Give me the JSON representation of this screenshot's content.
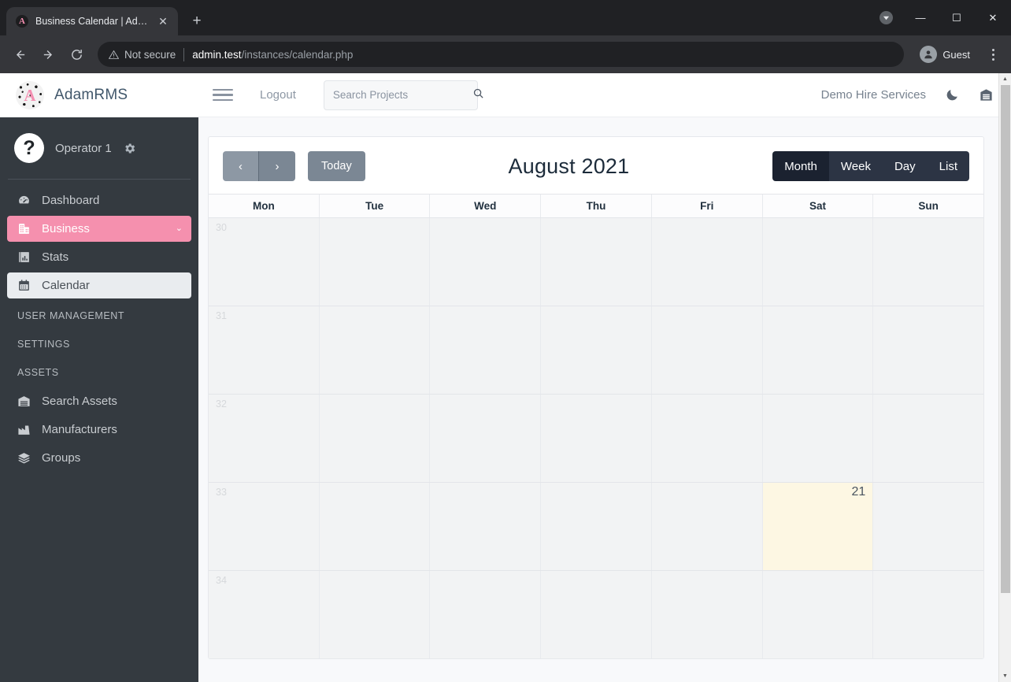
{
  "browser": {
    "tab": {
      "title": "Business Calendar | AdamRMS",
      "favicon_letter": "A",
      "close_icon": "close-icon"
    },
    "new_tab_label": "+",
    "nav": {
      "back_icon": "back-arrow-icon",
      "forward_icon": "forward-arrow-icon",
      "reload_icon": "reload-icon"
    },
    "omnibox": {
      "security_label": "Not secure",
      "url_host": "admin.test",
      "url_path": "/instances/calendar.php"
    },
    "profile_label": "Guest",
    "window_controls": {
      "minimize": "—",
      "maximize": "☐",
      "close": "✕"
    }
  },
  "sidebar": {
    "brand": {
      "name": "AdamRMS",
      "logo_letter": "A"
    },
    "user": {
      "name": "Operator 1",
      "avatar_glyph": "?",
      "settings_icon": "gear-icon"
    },
    "items": [
      {
        "label": "Dashboard",
        "icon": "dashboard-icon",
        "state": "default"
      },
      {
        "label": "Business",
        "icon": "building-icon",
        "state": "active-pink",
        "chevron": "⌄"
      },
      {
        "label": "Stats",
        "icon": "chart-bar-icon",
        "state": "default"
      },
      {
        "label": "Calendar",
        "icon": "calendar-icon",
        "state": "active-light"
      }
    ],
    "sections": [
      {
        "label": "User Management",
        "items": []
      },
      {
        "label": "Settings",
        "items": []
      },
      {
        "label": "Assets",
        "items": [
          {
            "label": "Search Assets",
            "icon": "warehouse-icon"
          },
          {
            "label": "Manufacturers",
            "icon": "factory-icon"
          },
          {
            "label": "Groups",
            "icon": "layers-icon"
          }
        ]
      }
    ]
  },
  "topbar": {
    "menu_toggle_icon": "hamburger-icon",
    "logout_label": "Logout",
    "search": {
      "placeholder": "Search Projects",
      "value": "",
      "icon": "search-icon"
    },
    "org_name": "Demo Hire Services",
    "dark_mode_icon": "moon-icon",
    "warehouse_icon": "warehouse-icon"
  },
  "calendar": {
    "prev_label": "‹",
    "next_label": "›",
    "today_label": "Today",
    "title": "August 2021",
    "views": [
      {
        "label": "Month",
        "active": true
      },
      {
        "label": "Week",
        "active": false
      },
      {
        "label": "Day",
        "active": false
      },
      {
        "label": "List",
        "active": false
      }
    ],
    "day_headers": [
      "Mon",
      "Tue",
      "Wed",
      "Thu",
      "Fri",
      "Sat",
      "Sun"
    ],
    "week_numbers": [
      "30",
      "31",
      "32",
      "33",
      "34"
    ],
    "rows": [
      {
        "week": "30",
        "cells": [
          {
            "day": "",
            "today": false
          },
          {
            "day": "",
            "today": false
          },
          {
            "day": "",
            "today": false
          },
          {
            "day": "",
            "today": false
          },
          {
            "day": "",
            "today": false
          },
          {
            "day": "",
            "today": false
          },
          {
            "day": "",
            "today": false
          }
        ]
      },
      {
        "week": "31",
        "cells": [
          {
            "day": "",
            "today": false
          },
          {
            "day": "",
            "today": false
          },
          {
            "day": "",
            "today": false
          },
          {
            "day": "",
            "today": false
          },
          {
            "day": "",
            "today": false
          },
          {
            "day": "",
            "today": false
          },
          {
            "day": "",
            "today": false
          }
        ]
      },
      {
        "week": "32",
        "cells": [
          {
            "day": "",
            "today": false
          },
          {
            "day": "",
            "today": false
          },
          {
            "day": "",
            "today": false
          },
          {
            "day": "",
            "today": false
          },
          {
            "day": "",
            "today": false
          },
          {
            "day": "",
            "today": false
          },
          {
            "day": "",
            "today": false
          }
        ]
      },
      {
        "week": "33",
        "cells": [
          {
            "day": "",
            "today": false
          },
          {
            "day": "",
            "today": false
          },
          {
            "day": "",
            "today": false
          },
          {
            "day": "",
            "today": false
          },
          {
            "day": "",
            "today": false
          },
          {
            "day": "21",
            "today": true
          },
          {
            "day": "",
            "today": false
          }
        ]
      },
      {
        "week": "34",
        "cells": [
          {
            "day": "",
            "today": false
          },
          {
            "day": "",
            "today": false
          },
          {
            "day": "",
            "today": false
          },
          {
            "day": "",
            "today": false
          },
          {
            "day": "",
            "today": false
          },
          {
            "day": "",
            "today": false
          },
          {
            "day": "",
            "today": false
          }
        ]
      }
    ]
  },
  "colors": {
    "sidebar_bg": "#343a40",
    "accent_pink": "#f590ae",
    "today_highlight": "#fdf7e3",
    "view_button_bg": "#2c3444",
    "nav_button_bg": "#7b8794"
  }
}
